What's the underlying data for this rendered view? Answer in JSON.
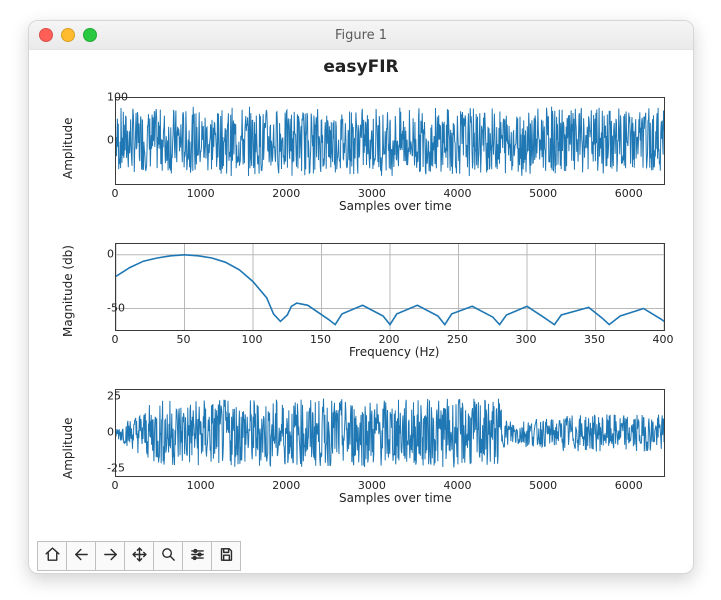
{
  "window": {
    "title": "Figure 1"
  },
  "traffic": {
    "close": "#ff5f57",
    "min": "#febc2e",
    "max": "#28c840"
  },
  "suptitle": "easyFIR",
  "toolbar": {
    "home": "Home",
    "back": "Back",
    "forward": "Forward",
    "pan": "Pan",
    "zoom": "Zoom",
    "configure": "Configure subplots",
    "save": "Save"
  },
  "chart_data": [
    {
      "type": "line",
      "title": "",
      "xlabel": "Samples over time",
      "ylabel": "Amplitude",
      "xlim": [
        0,
        6400
      ],
      "ylim": [
        -100,
        100
      ],
      "xticks": [
        0,
        1000,
        2000,
        3000,
        4000,
        5000,
        6000
      ],
      "yticks": [
        0,
        100
      ],
      "grid": false,
      "note": "noisy input signal, amplitude roughly ±80 across full range",
      "x": [
        0,
        6400
      ],
      "values": "dense-noise"
    },
    {
      "type": "line",
      "title": "",
      "xlabel": "Frequency (Hz)",
      "ylabel": "Magnitude (db)",
      "xlim": [
        0,
        400
      ],
      "ylim": [
        -70,
        10
      ],
      "xticks": [
        0,
        50,
        100,
        150,
        200,
        250,
        300,
        350,
        400
      ],
      "yticks": [
        -50,
        0
      ],
      "grid": true,
      "x": [
        0,
        10,
        20,
        30,
        40,
        50,
        60,
        70,
        80,
        90,
        100,
        110,
        115,
        120,
        125,
        128,
        132,
        140,
        155,
        160,
        165,
        180,
        195,
        200,
        205,
        220,
        235,
        240,
        245,
        260,
        275,
        280,
        285,
        300,
        312,
        320,
        325,
        345,
        355,
        360,
        368,
        385,
        398,
        400
      ],
      "values": [
        -20,
        -12,
        -6,
        -3,
        -1,
        0,
        -1,
        -3,
        -7,
        -14,
        -25,
        -40,
        -55,
        -62,
        -56,
        -48,
        -45,
        -47,
        -60,
        -65,
        -55,
        -47,
        -57,
        -65,
        -55,
        -47,
        -57,
        -65,
        -55,
        -48,
        -58,
        -65,
        -56,
        -48,
        -58,
        -65,
        -56,
        -49,
        -59,
        -65,
        -57,
        -50,
        -60,
        -62
      ]
    },
    {
      "type": "line",
      "title": "",
      "xlabel": "Samples over time",
      "ylabel": "Amplitude",
      "xlim": [
        0,
        6400
      ],
      "ylim": [
        -30,
        30
      ],
      "xticks": [
        0,
        1000,
        2000,
        3000,
        4000,
        5000,
        6000
      ],
      "yticks": [
        -25,
        0,
        25
      ],
      "grid": false,
      "note": "filtered output, envelope ramps up by ~600, stays ±25 until ~4500, drops to ±12",
      "x": [
        0,
        6400
      ],
      "values": "dense-noise-shaped"
    }
  ]
}
